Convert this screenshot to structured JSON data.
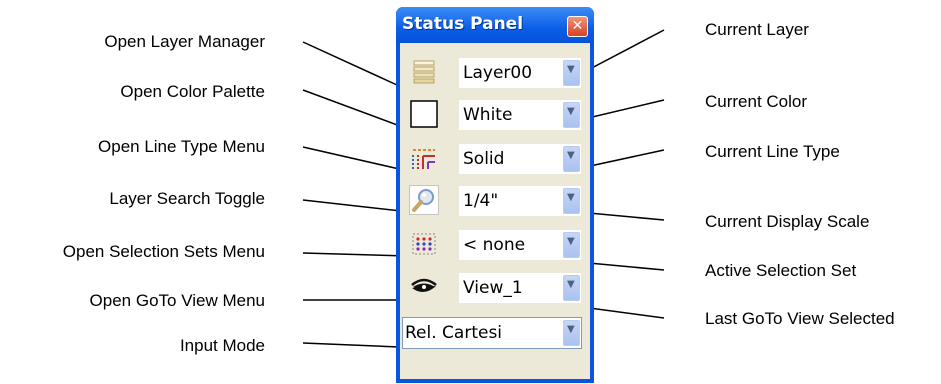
{
  "panel": {
    "title": "Status Panel",
    "close_glyph": "✕",
    "rows": [
      {
        "icon": "layer-stack-icon",
        "value": "Layer00"
      },
      {
        "icon": "color-swatch-icon",
        "value": "White"
      },
      {
        "icon": "line-type-icon",
        "value": "Solid"
      },
      {
        "icon": "magnifier-search-icon",
        "value": "1/4\""
      },
      {
        "icon": "selection-set-icon",
        "value": "< none"
      },
      {
        "icon": "eye-icon",
        "value": "View_1"
      }
    ],
    "input_mode": "Rel. Cartesi",
    "dropdown_glyph": "▼"
  },
  "callouts": {
    "left": [
      "Open Layer Manager",
      "Open Color Palette",
      "Open Line Type Menu",
      "Layer Search Toggle",
      "Open Selection Sets Menu",
      "Open GoTo View Menu",
      "Input Mode"
    ],
    "right": [
      "Current Layer",
      "Current Color",
      "Current Line Type",
      "Current Display Scale",
      "Active Selection Set",
      "Last GoTo View Selected"
    ]
  }
}
